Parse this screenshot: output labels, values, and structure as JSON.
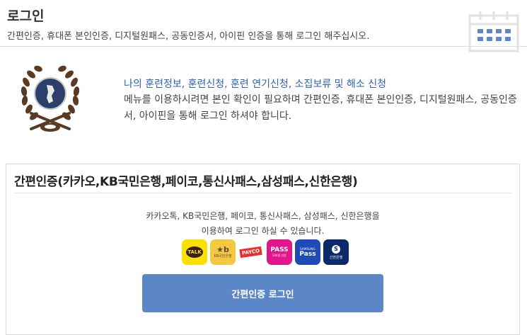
{
  "header": {
    "title": "로그인",
    "subtitle": "간편인증, 휴대폰 본인인증, 디지털원패스, 공동인증서, 아이핀 인증을 통해 로그인 해주십시오."
  },
  "info": {
    "highlight": "나의 훈련정보, 훈련신청, 훈련 연기신청, 소집보류 및 해소 신청",
    "text": "메뉴를 이용하시려면 본인 확인이 필요하며 간편인증, 휴대폰 본인인증, 디지털원패스, 공동인증서, 아이핀을 통해 로그인 하셔야 합니다."
  },
  "simple_auth": {
    "title": "간편인증(카카오,KB국민은행,페이코,통신사패스,삼성패스,신한은행)",
    "desc_line1": "카카오톡, KB국민은행, 페이코, 통신사패스, 삼성패스, 신한은행을",
    "desc_line2": "이용하여 로그인 하실 수 있습니다.",
    "providers": {
      "kakao": "TALK",
      "kb_mark": "★b",
      "kb_sub": "KB국민은행",
      "payco": "PAYCO",
      "pass_main": "PASS",
      "pass_sub": "모바일 인증",
      "samsung_top": "SAMSUNG",
      "samsung_main": "Pass",
      "shinhan_mark": "S",
      "shinhan_sub": "신한은행"
    },
    "button_label": "간편인증 로그인"
  },
  "colors": {
    "accent_blue": "#2f62b3",
    "button": "#5b86c8",
    "kakao": "#fae100",
    "kb": "#f5c842",
    "payco": "#e8312f",
    "pass": "#e0168a",
    "samsung": "#1f4bb6",
    "shinhan": "#0a2a6b"
  },
  "icons": [
    "calendar-icon",
    "reserve-forces-emblem"
  ]
}
